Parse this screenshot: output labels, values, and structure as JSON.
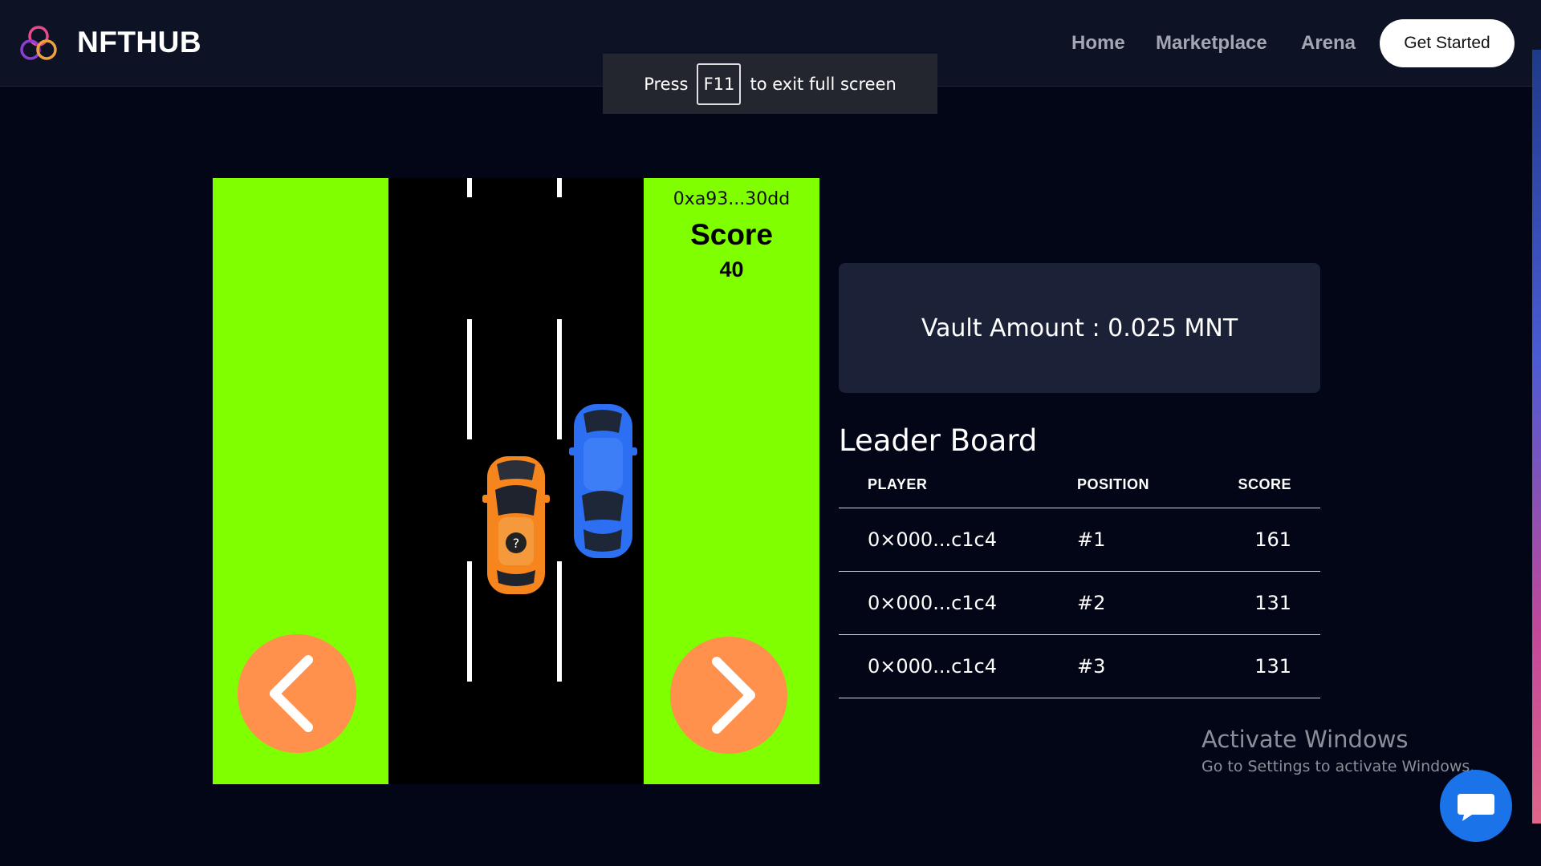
{
  "header": {
    "brand": "NFTHUB",
    "logo_icon": "triple-ring-logo-icon",
    "nav": {
      "home": "Home",
      "marketplace": "Marketplace",
      "arena": "Arena"
    },
    "cta_label": "Get Started"
  },
  "fullscreen_notice": {
    "press": "Press",
    "key": "F11",
    "message": "to exit full screen"
  },
  "game": {
    "player_address": "0xa93...30dd",
    "score_label": "Score",
    "score_value": "40",
    "left_control_icon": "chevron-left-icon",
    "right_control_icon": "chevron-right-icon",
    "cars": [
      "orange-player-car",
      "blue-opponent-car"
    ],
    "colors": {
      "grass": "#80ff00",
      "road": "#000000",
      "control": "#ff914d",
      "player_car": "#f7851e",
      "opponent_car": "#2d6ff2"
    }
  },
  "vault": {
    "text": "Vault Amount : 0.025 MNT"
  },
  "leaderboard": {
    "title": "Leader Board",
    "columns": {
      "player": "PLAYER",
      "position": "POSITION",
      "score": "SCORE"
    },
    "rows": [
      {
        "player": "0×000...c1c4",
        "position": "#1",
        "score": "161"
      },
      {
        "player": "0×000...c1c4",
        "position": "#2",
        "score": "131"
      },
      {
        "player": "0×000...c1c4",
        "position": "#3",
        "score": "131"
      }
    ]
  },
  "windows_watermark": {
    "title": "Activate Windows",
    "subtitle": "Go to Settings to activate Windows."
  },
  "chat": {
    "icon": "chat-bubble-icon"
  }
}
